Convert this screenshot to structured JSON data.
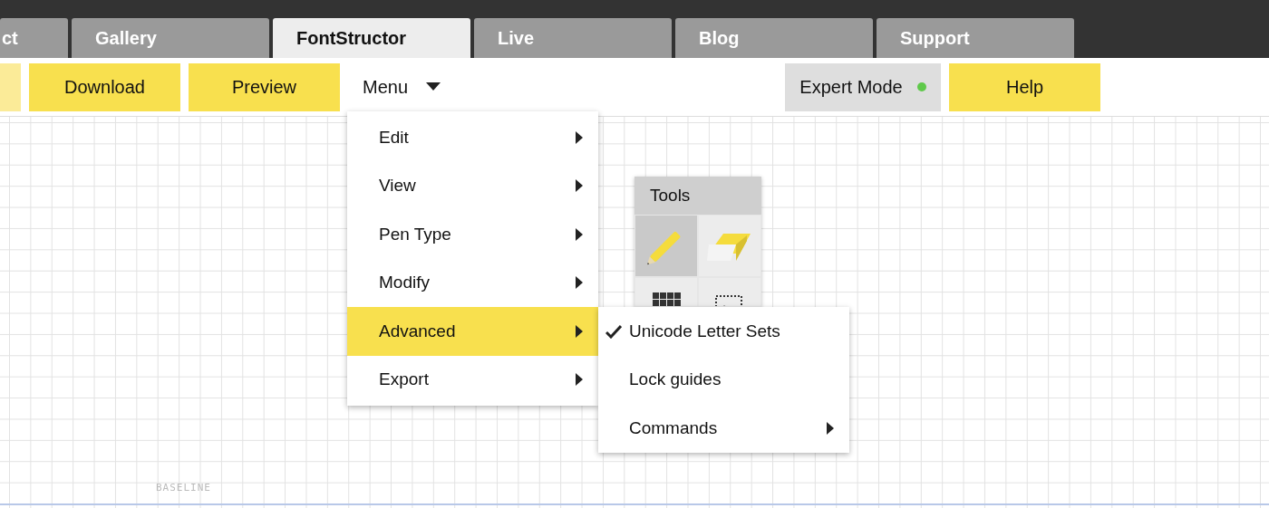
{
  "tabs": [
    {
      "label": "ct",
      "selected": false
    },
    {
      "label": "Gallery",
      "selected": false
    },
    {
      "label": "FontStructor",
      "selected": true
    },
    {
      "label": "Live",
      "selected": false
    },
    {
      "label": "Blog",
      "selected": false
    },
    {
      "label": "Support",
      "selected": false
    }
  ],
  "toolbar": {
    "buttons": [
      {
        "label": "Download"
      },
      {
        "label": "Preview"
      }
    ],
    "menu": {
      "label": "Menu",
      "expanded": true
    },
    "expert_mode": {
      "label": "Expert Mode",
      "on": true
    },
    "help": {
      "label": "Help"
    }
  },
  "menu": [
    {
      "label": "Edit",
      "selected": false
    },
    {
      "label": "View",
      "selected": false
    },
    {
      "label": "Pen Type",
      "selected": false
    },
    {
      "label": "Modify",
      "selected": false
    },
    {
      "label": "Advanced",
      "selected": true
    },
    {
      "label": "Export",
      "selected": false
    }
  ],
  "submenu": [
    {
      "label": "Unicode Letter Sets",
      "checked": true,
      "has_submenu": false
    },
    {
      "label": "Lock guides",
      "checked": false,
      "has_submenu": false
    },
    {
      "label": "Commands",
      "checked": false,
      "has_submenu": true
    }
  ],
  "tools": {
    "title": "Tools",
    "items": [
      {
        "kind": "pencil",
        "selected": true
      },
      {
        "kind": "eraser",
        "selected": false
      },
      {
        "kind": "grid",
        "selected": false
      },
      {
        "kind": "select",
        "selected": false
      }
    ]
  },
  "canvas": {
    "baseline_label": "BASELINE"
  }
}
